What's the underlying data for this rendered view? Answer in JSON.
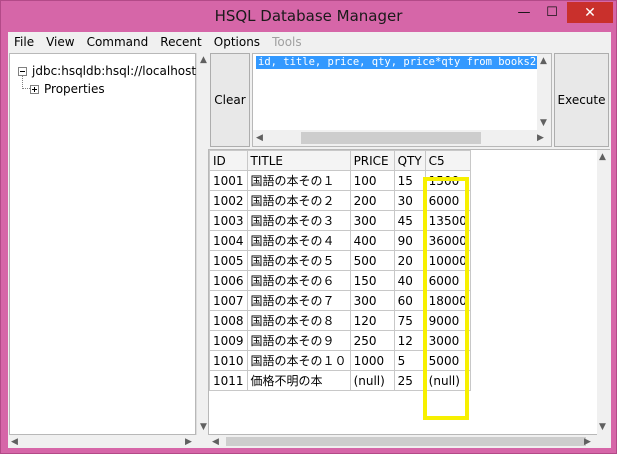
{
  "window": {
    "title": "HSQL Database Manager",
    "min": "—",
    "max": "☐",
    "close": "✕"
  },
  "menu": [
    {
      "label": "File",
      "enabled": true
    },
    {
      "label": "View",
      "enabled": true
    },
    {
      "label": "Command",
      "enabled": true
    },
    {
      "label": "Recent",
      "enabled": true
    },
    {
      "label": "Options",
      "enabled": true
    },
    {
      "label": "Tools",
      "enabled": false
    }
  ],
  "tree": {
    "root_label": "jdbc:hsqldb:hsql://localhost/",
    "child_label": "Properties"
  },
  "buttons": {
    "clear": "Clear",
    "execute": "Execute"
  },
  "sql": {
    "text": "id, title, price, qty, price*qty from books2;"
  },
  "results": {
    "columns": [
      "ID",
      "TITLE",
      "PRICE",
      "QTY",
      "C5"
    ],
    "rows": [
      [
        "1001",
        "国語の本その１",
        "100",
        "15",
        "1500"
      ],
      [
        "1002",
        "国語の本その２",
        "200",
        "30",
        "6000"
      ],
      [
        "1003",
        "国語の本その３",
        "300",
        "45",
        "13500"
      ],
      [
        "1004",
        "国語の本その４",
        "400",
        "90",
        "36000"
      ],
      [
        "1005",
        "国語の本その５",
        "500",
        "20",
        "10000"
      ],
      [
        "1006",
        "国語の本その６",
        "150",
        "40",
        "6000"
      ],
      [
        "1007",
        "国語の本その７",
        "300",
        "60",
        "18000"
      ],
      [
        "1008",
        "国語の本その８",
        "120",
        "75",
        "9000"
      ],
      [
        "1009",
        "国語の本その９",
        "250",
        "12",
        "3000"
      ],
      [
        "1010",
        "国語の本その１０",
        "1000",
        "5",
        "5000"
      ],
      [
        "1011",
        "価格不明の本",
        "(null)",
        "25",
        "(null)"
      ]
    ],
    "highlight_color": "#f7f000"
  }
}
